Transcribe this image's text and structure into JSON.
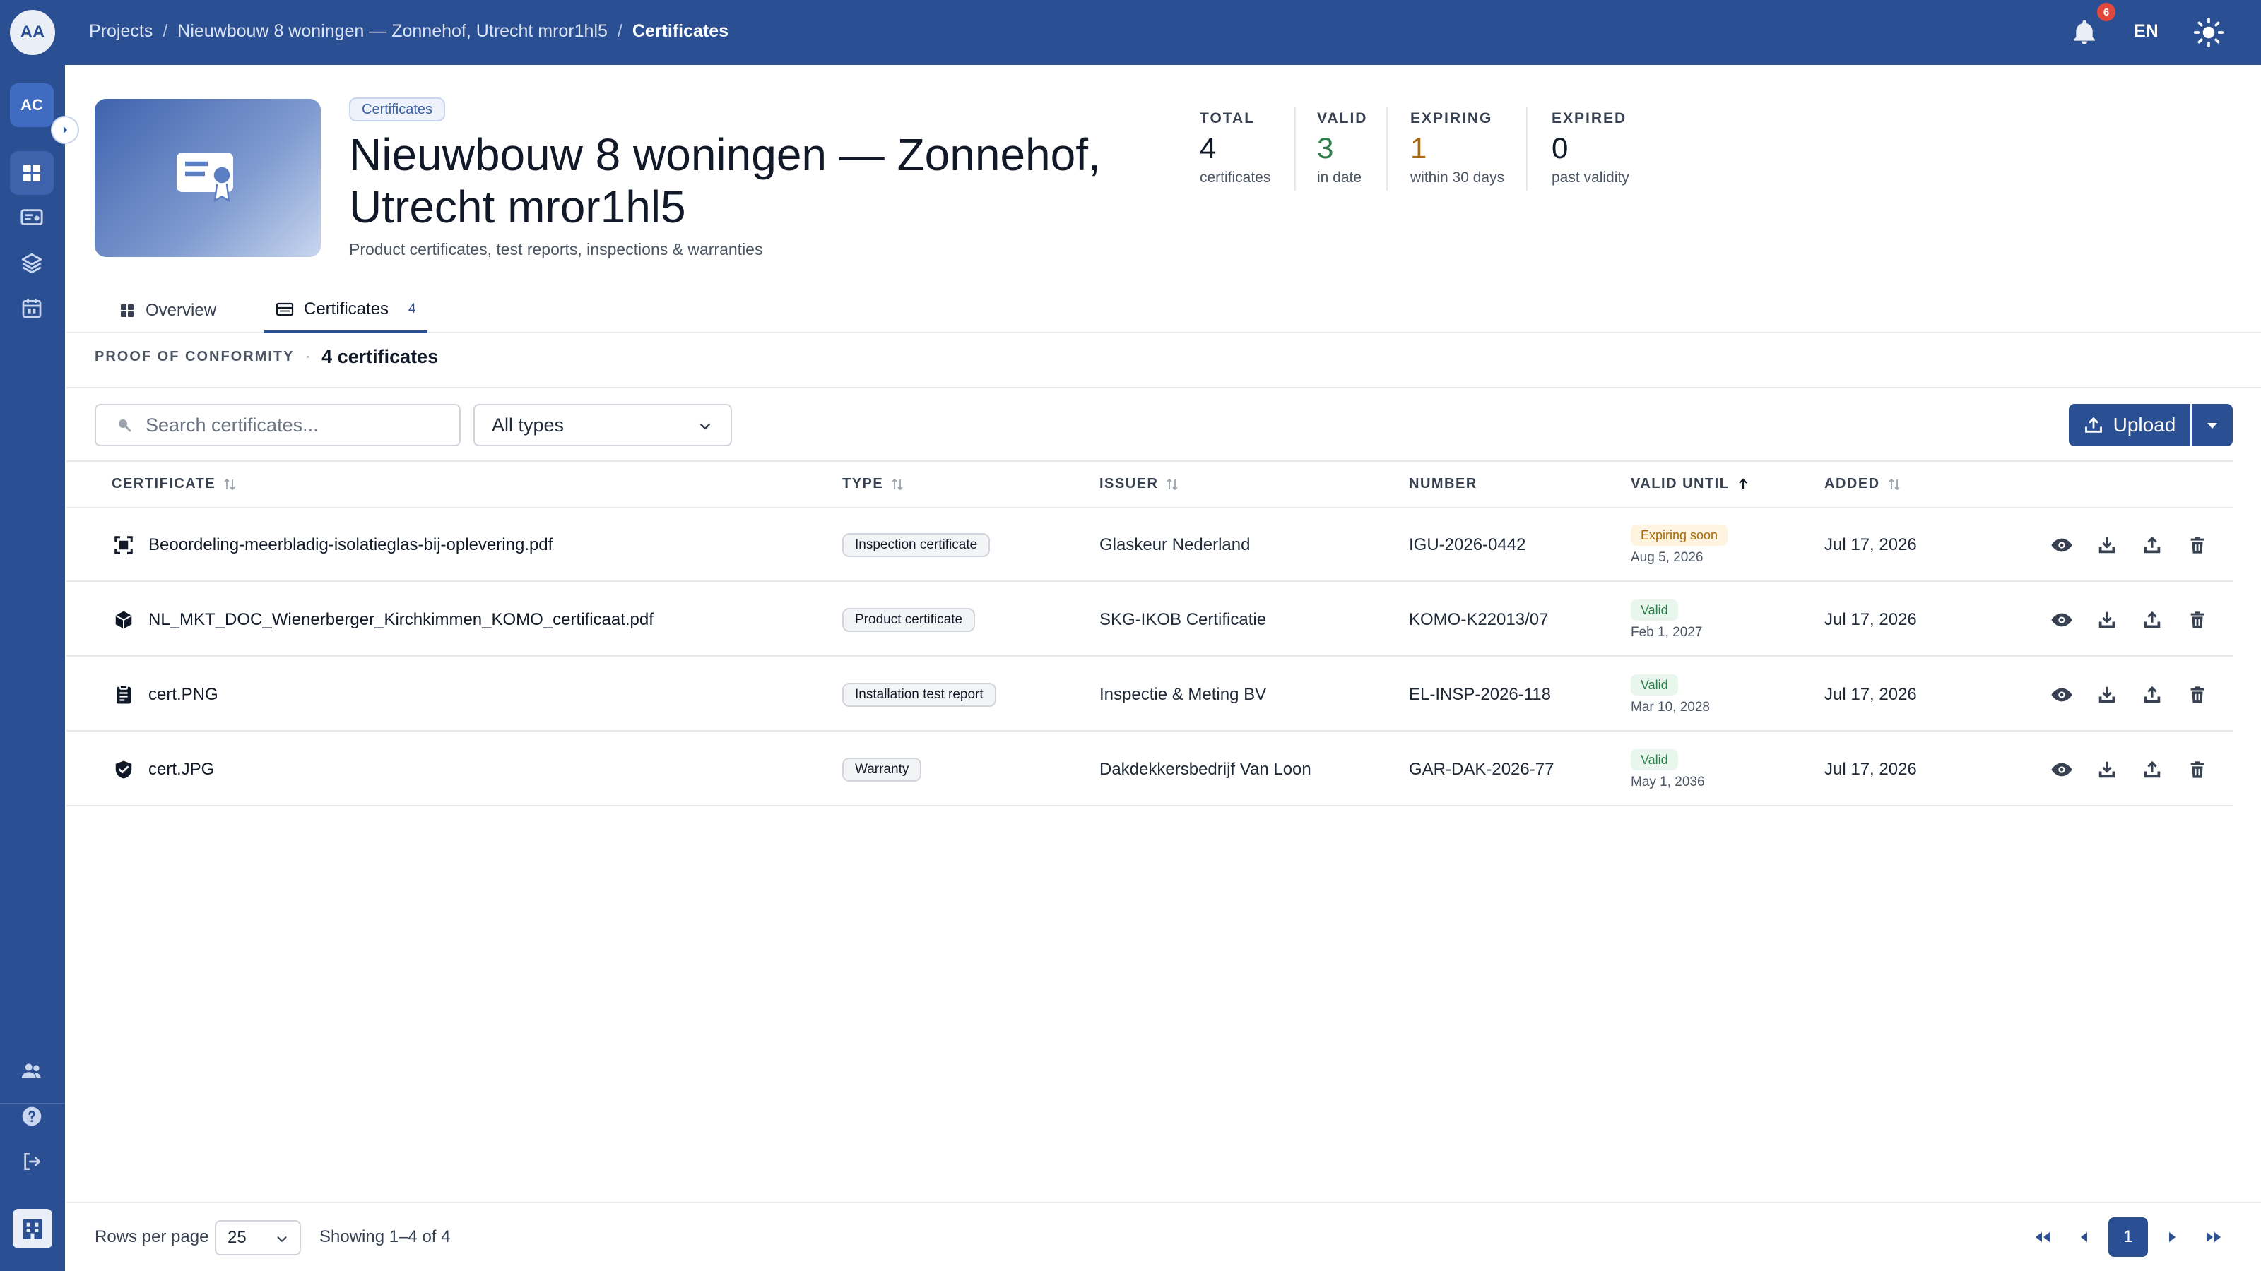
{
  "user": {
    "initials": "AA"
  },
  "workspace": {
    "initials": "AC"
  },
  "breadcrumb": {
    "items": [
      "Projects",
      "Nieuwbouw 8 woningen — Zonnehof, Utrecht mror1hl5",
      "Certificates"
    ],
    "separator": "/"
  },
  "header": {
    "notification_count": "6",
    "language": "EN"
  },
  "project": {
    "chip": "Certificates",
    "title": "Nieuwbouw 8 woningen — Zonnehof, Utrecht mror1hl5",
    "subtitle": "Product certificates, test reports, inspections & warranties"
  },
  "stats": [
    {
      "label": "TOTAL",
      "value": "4",
      "sub": "certificates",
      "color": "#111827"
    },
    {
      "label": "VALID",
      "value": "3",
      "sub": "in date",
      "color": "#2f7d4b"
    },
    {
      "label": "EXPIRING",
      "value": "1",
      "sub": "within 30 days",
      "color": "#a8690d"
    },
    {
      "label": "EXPIRED",
      "value": "0",
      "sub": "past validity",
      "color": "#111827"
    }
  ],
  "tabs": [
    {
      "label": "Overview"
    },
    {
      "label": "Certificates",
      "count": "4"
    }
  ],
  "section": {
    "label": "PROOF OF CONFORMITY",
    "separator": "·",
    "count_text": "4 certificates"
  },
  "toolbar": {
    "search_placeholder": "Search certificates...",
    "type_filter": "All types",
    "upload_label": "Upload"
  },
  "table": {
    "columns": [
      "CERTIFICATE",
      "TYPE",
      "ISSUER",
      "NUMBER",
      "VALID UNTIL",
      "ADDED"
    ],
    "rows": [
      {
        "icon": "scan-icon",
        "name": "Beoordeling-meerbladig-isolatieglas-bij-oplevering.pdf",
        "type": "Inspection certificate",
        "issuer": "Glaskeur Nederland",
        "number": "IGU-2026-0442",
        "status": "Expiring soon",
        "status_kind": "warn",
        "valid_until": "Aug 5, 2026",
        "added": "Jul 17, 2026"
      },
      {
        "icon": "package-icon",
        "name": "NL_MKT_DOC_Wienerberger_Kirchkimmen_KOMO_certificaat.pdf",
        "type": "Product certificate",
        "issuer": "SKG-IKOB Certificatie",
        "number": "KOMO-K22013/07",
        "status": "Valid",
        "status_kind": "ok",
        "valid_until": "Feb 1, 2027",
        "added": "Jul 17, 2026"
      },
      {
        "icon": "clipboard-icon",
        "name": "cert.PNG",
        "type": "Installation test report",
        "issuer": "Inspectie & Meting BV",
        "number": "EL-INSP-2026-118",
        "status": "Valid",
        "status_kind": "ok",
        "valid_until": "Mar 10, 2028",
        "added": "Jul 17, 2026"
      },
      {
        "icon": "shield-check-icon",
        "name": "cert.JPG",
        "type": "Warranty",
        "issuer": "Dakdekkersbedrijf Van Loon",
        "number": "GAR-DAK-2026-77",
        "status": "Valid",
        "status_kind": "ok",
        "valid_until": "May 1, 2036",
        "added": "Jul 17, 2026"
      }
    ]
  },
  "footer": {
    "rows_per_page_label": "Rows per page",
    "rows_per_page": "25",
    "showing": "Showing 1–4 of 4",
    "current_page": "1"
  },
  "colors": {
    "brand": "#2b4f93",
    "valid": "#2f7d4b",
    "expiring": "#a8690d"
  }
}
